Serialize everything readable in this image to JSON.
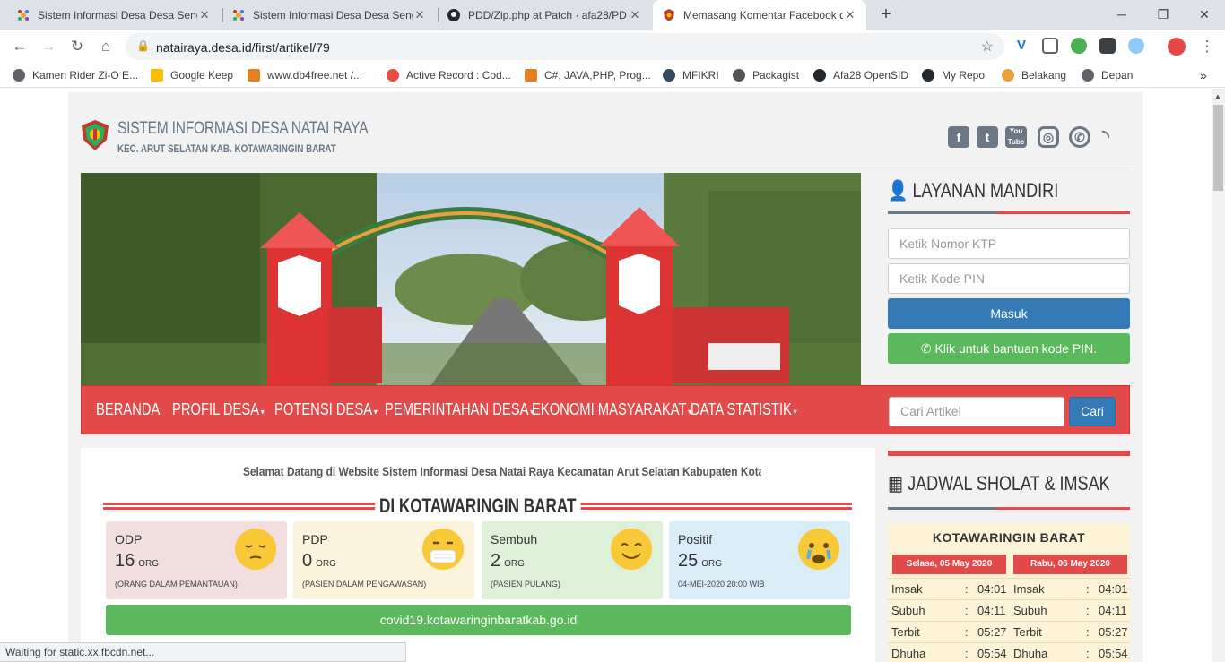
{
  "browser": {
    "tabs": [
      {
        "title": "Sistem Informasi Desa Desa Seng",
        "icon": "opensid-icon"
      },
      {
        "title": "Sistem Informasi Desa Desa Seng",
        "icon": "opensid-icon"
      },
      {
        "title": "PDD/Zip.php at Patch · afa28/PD",
        "icon": "github-icon"
      },
      {
        "title": "Memasang Komentar Facebook d",
        "icon": "kotawaringin-icon"
      }
    ],
    "new_tab": "+",
    "url": "natairaya.desa.id/first/artikel/79",
    "bookmarks": [
      {
        "label": "Kamen Rider Zi-O E..."
      },
      {
        "label": "Google Keep"
      },
      {
        "label": "www.db4free.net /..."
      },
      {
        "label": "Active Record : Cod..."
      },
      {
        "label": "C#, JAVA,PHP, Prog..."
      },
      {
        "label": "MFIKRI"
      },
      {
        "label": "Packagist"
      },
      {
        "label": "Afa28 OpenSID"
      },
      {
        "label": "My Repo"
      },
      {
        "label": "Belakang"
      },
      {
        "label": "Depan"
      }
    ],
    "more_bookmarks": "»",
    "status": "Waiting for static.xx.fbcdn.net..."
  },
  "site": {
    "title": "SISTEM INFORMASI DESA NATAI RAYA",
    "subtitle": "KEC. ARUT SELATAN KAB. KOTAWARINGIN BARAT",
    "social": [
      "facebook-icon",
      "twitter-icon",
      "youtube-icon",
      "instagram-icon",
      "whatsapp-icon",
      "rss-icon"
    ]
  },
  "nav": {
    "items": [
      "BERANDA",
      "PROFIL DESA",
      "POTENSI DESA",
      "PEMERINTAHAN DESA",
      "EKONOMI MASYARAKAT",
      "DATA STATISTIK"
    ],
    "search_placeholder": "Cari Artikel",
    "search_button": "Cari"
  },
  "layanan": {
    "title": "LAYANAN MANDIRI",
    "ktp_placeholder": "Ketik Nomor KTP",
    "pin_placeholder": "Ketik Kode PIN",
    "login_button": "Masuk",
    "help_button": "Klik untuk bantuan kode PIN."
  },
  "content": {
    "marquee": "Selamat Datang di Website Sistem Informasi Desa Natai Raya Kecamatan Arut Selatan Kabupaten Kotawaringin Barat | Kantor",
    "covid_title": "DI KOTAWARINGIN BARAT",
    "cards": [
      {
        "label": "ODP",
        "value": "16",
        "unit": "ORG",
        "desc": "(ORANG DALAM PEMANTAUAN)",
        "bg": "#f2dede",
        "emoji": "pensive-face-icon"
      },
      {
        "label": "PDP",
        "value": "0",
        "unit": "ORG",
        "desc": "(PASIEN DALAM PENGAWASAN)",
        "bg": "#fcf3dc",
        "emoji": "mask-face-icon"
      },
      {
        "label": "Sembuh",
        "value": "2",
        "unit": "ORG",
        "desc": "(PASIEN PULANG)",
        "bg": "#dff0d8",
        "emoji": "smiling-face-icon"
      },
      {
        "label": "Positif",
        "value": "25",
        "unit": "ORG",
        "desc": "04-MEI-2020 20:00 WIB",
        "bg": "#d9edf7",
        "emoji": "crying-face-icon"
      }
    ],
    "covid_link": "covid19.kotawaringinbaratkab.go.id"
  },
  "jadwal": {
    "title": "JADWAL SHOLAT & IMSAK",
    "city": "KOTAWARINGIN BARAT",
    "dates": [
      "Selasa, 05 May 2020",
      "Rabu, 06 May 2020"
    ],
    "rows": [
      {
        "name": "Imsak",
        "sep": ":",
        "t1": "04:01",
        "t2": "04:01"
      },
      {
        "name": "Subuh",
        "sep": ":",
        "t1": "04:11",
        "t2": "04:11"
      },
      {
        "name": "Terbit",
        "sep": ":",
        "t1": "05:27",
        "t2": "05:27"
      },
      {
        "name": "Dhuha",
        "sep": ":",
        "t1": "05:54",
        "t2": "05:54"
      }
    ]
  },
  "colors": {
    "accent": "#e34a4a",
    "primary": "#337ab7",
    "success": "#5cb85c"
  }
}
